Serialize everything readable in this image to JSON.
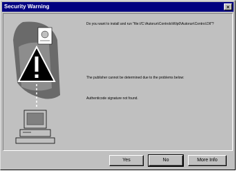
{
  "window": {
    "title": "Security Warning",
    "close_glyph": "×"
  },
  "message": {
    "question": "Do you want to install and run \"file://C:\\Autorun\\Controls\\Wip0\\Autorun\\Control.Dll\"?",
    "publisher_note": "The publisher cannot be determined due to the problems below:",
    "authenticode": "Authenticode signature not found."
  },
  "buttons": {
    "yes_label": "Yes",
    "no_label": "No",
    "more_label": "More Info"
  },
  "icons": {
    "illustration": "security-warning-illustration",
    "warning": "warning-triangle-icon",
    "computer": "computer-icon",
    "certificate": "certificate-icon"
  },
  "colors": {
    "titlebar": "#000080",
    "face": "#c0c0c0",
    "warning_fill": "#000000",
    "warning_glyph": "#ffffff"
  }
}
